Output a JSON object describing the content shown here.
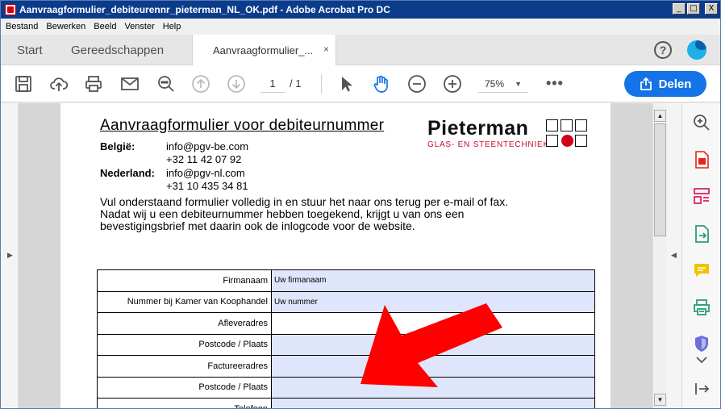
{
  "window": {
    "title": "Aanvraagformulier_debiteurennr_pieterman_NL_OK.pdf - Adobe Acrobat Pro DC",
    "min_label": "_",
    "max_label": "□",
    "close_label": "X"
  },
  "menu": [
    "Bestand",
    "Bewerken",
    "Beeld",
    "Venster",
    "Help"
  ],
  "tabs": {
    "start": "Start",
    "tools": "Gereedschappen",
    "document": "Aanvraagformulier_...",
    "close": "×"
  },
  "header": {
    "help": "?"
  },
  "toolbar": {
    "page_current": "1",
    "page_total": "/ 1",
    "zoom": "75%",
    "more": "•••",
    "share": "Delen"
  },
  "document": {
    "title": "Aanvraagformulier voor debiteurnummer",
    "contacts": [
      {
        "country": "België:",
        "lines": [
          "info@pgv-be.com",
          "+32 11 42 07 92"
        ]
      },
      {
        "country": "Nederland:",
        "lines": [
          "info@pgv-nl.com",
          "+31 10 435 34 81"
        ]
      }
    ],
    "intro": [
      "Vul onderstaand formulier volledig in en stuur het naar ons terug per e-mail of fax.",
      "Nadat wij u een debiteurnummer hebben toegekend, krijgt u van ons een",
      "bevestigingsbrief met daarin ook de inlogcode voor de website."
    ],
    "logo": {
      "name": "Pieterman",
      "sub": "GLAS- EN STEENTECHNIEK"
    },
    "form_rows": [
      {
        "label": "Firmanaam",
        "value": "Uw firmanaam",
        "filled": true
      },
      {
        "label": "Nummer bij Kamer van Koophandel",
        "value": "Uw nummer",
        "filled": true
      },
      {
        "label": "Afleveradres",
        "value": "",
        "filled": false
      },
      {
        "label": "Postcode / Plaats",
        "value": "",
        "filled": true
      },
      {
        "label": "Factureeradres",
        "value": "",
        "filled": true
      },
      {
        "label": "Postcode / Plaats",
        "value": "",
        "filled": true
      },
      {
        "label": "Telefoon",
        "value": "",
        "filled": true
      }
    ]
  },
  "colors": {
    "accent": "#1473e6",
    "field_fill": "#dfe6fb",
    "logo_red": "#d0021b",
    "annotation_arrow": "#ff0000"
  },
  "icons": {
    "toolbar": [
      "save-icon",
      "cloud-upload-icon",
      "print-icon",
      "email-icon",
      "zoom-search-icon",
      "page-up-icon",
      "page-down-icon",
      "select-cursor-icon",
      "hand-tool-icon",
      "zoom-out-icon",
      "zoom-in-icon"
    ],
    "right_pane": [
      "enhance-zoom-icon",
      "export-pdf-icon",
      "organize-pages-icon",
      "edit-pdf-icon",
      "comment-icon",
      "print-production-icon",
      "protect-icon",
      "collapse-chevron-icon",
      "exit-panel-icon"
    ]
  }
}
